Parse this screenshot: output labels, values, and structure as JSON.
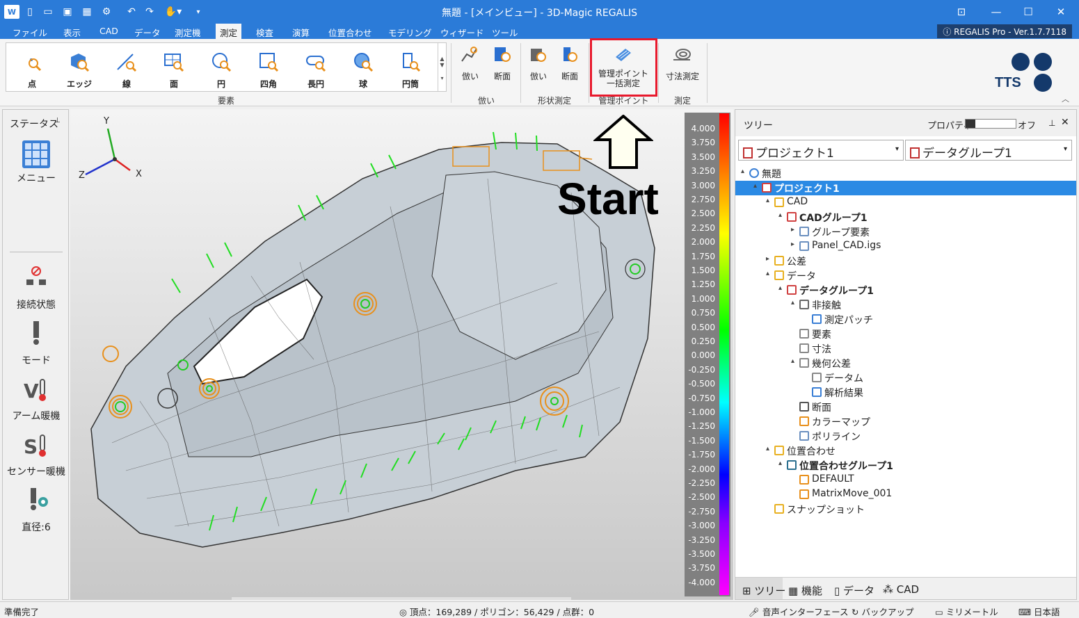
{
  "window": {
    "title": "無題 - [メインビュー] - 3D-Magic REGALIS",
    "minimize": "—",
    "maximize": "☐",
    "close": "✕"
  },
  "menus": [
    "ファイル",
    "表示",
    "CAD",
    "データ",
    "測定機",
    "測定",
    "検査",
    "演算",
    "位置合わせ",
    "モデリング",
    "ウィザード",
    "ツール"
  ],
  "active_menu": "測定",
  "version": "REGALIS Pro - Ver.1.7.7118",
  "ribbon": {
    "elements": [
      "点",
      "エッジ",
      "線",
      "面",
      "円",
      "四角",
      "長円",
      "球",
      "円筒"
    ],
    "group_elements": "要素",
    "copy_buttons": [
      "倣い",
      "断面"
    ],
    "group_copy": "倣い",
    "shape_buttons": [
      "倣い",
      "断面"
    ],
    "group_shape": "形状測定",
    "mgmt_button_line1": "管理ポイント",
    "mgmt_button_line2": "一括測定",
    "group_mgmt": "管理ポイント",
    "dim_button": "寸法測定",
    "group_measure": "測定",
    "logo_text": "TTS"
  },
  "left_panel": {
    "status": "ステータス",
    "menu": "メニュー",
    "connection": "接続状態",
    "mode": "モード",
    "arm_warm": "アーム暖機",
    "sensor_warm": "センサー暖機",
    "diameter": "直径:6"
  },
  "viewport": {
    "axis_x": "X",
    "axis_y": "Y",
    "axis_z": "Z"
  },
  "annotation": {
    "start": "Start"
  },
  "colormap": [
    "4.000",
    "3.750",
    "3.500",
    "3.250",
    "3.000",
    "2.750",
    "2.500",
    "2.250",
    "2.000",
    "1.750",
    "1.500",
    "1.250",
    "1.000",
    "0.750",
    "0.500",
    "0.250",
    "0.000",
    "-0.250",
    "-0.500",
    "-0.750",
    "-1.000",
    "-1.250",
    "-1.500",
    "-1.750",
    "-2.000",
    "-2.250",
    "-2.500",
    "-2.750",
    "-3.000",
    "-3.250",
    "-3.500",
    "-3.750",
    "-4.000"
  ],
  "right_panel": {
    "title": "ツリー",
    "property": "プロパティ",
    "off": "オフ",
    "project_combo": "プロジェクト1",
    "data_combo": "データグループ1",
    "tree": [
      "無題",
      "プロジェクト1",
      "CAD",
      "CADグループ1",
      "グループ要素",
      "Panel_CAD.igs",
      "公差",
      "データ",
      "データグループ1",
      "非接触",
      "測定パッチ",
      "要素",
      "寸法",
      "幾何公差",
      "データム",
      "解析結果",
      "断面",
      "カラーマップ",
      "ポリライン",
      "位置合わせ",
      "位置合わせグループ1",
      "DEFAULT",
      "MatrixMove_001",
      "スナップショット"
    ],
    "tabs": [
      "ツリー",
      "機能",
      "データ",
      "CAD"
    ]
  },
  "status": {
    "left": "準備完了",
    "counts": "頂点：169,289 / ポリゴン：56,429 / 点群：0",
    "voice": "音声インターフェース",
    "backup": "バックアップ",
    "unit": "ミリメートル",
    "lang": "日本語"
  }
}
